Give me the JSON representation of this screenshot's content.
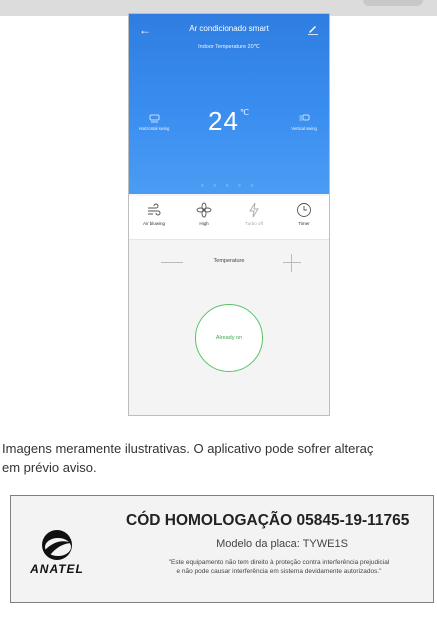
{
  "phone": {
    "app_title": "Ar condicionado smart",
    "indoor_temperature": "Indoor Temperature 20℃",
    "set_temperature": "24",
    "temperature_unit": "℃",
    "horizontal_swing": "Horizontal swing",
    "vertical_swing": "Vertical swing",
    "page_dots": "○ ○ ○ ○ ○",
    "controls": [
      {
        "label": "Air blowing",
        "icon": "wind-icon"
      },
      {
        "label": "High",
        "icon": "fan-icon"
      },
      {
        "label": "Turbo off",
        "icon": "bolt-icon"
      },
      {
        "label": "Timer",
        "icon": "clock-icon"
      }
    ],
    "temperature_label": "Temperature",
    "power_status": "Already on"
  },
  "note": {
    "line1": "Imagens meramente ilustrativas. O aplicativo pode sofrer alteraç",
    "line2": "em prévio aviso."
  },
  "certification": {
    "logo_text": "ANATEL",
    "code": "CÓD HOMOLOGAÇÃO 05845-19-11765",
    "model": "Modelo da placa: TYWE1S",
    "disclaimer_line1": "\"Este equipamento não tem direito à proteção contra interferência prejudicial",
    "disclaimer_line2": "e não pode causar interferência em sistema devidamente autorizados.\""
  },
  "colors": {
    "header_blue": "#2f7de1",
    "power_green": "#59c26a"
  }
}
